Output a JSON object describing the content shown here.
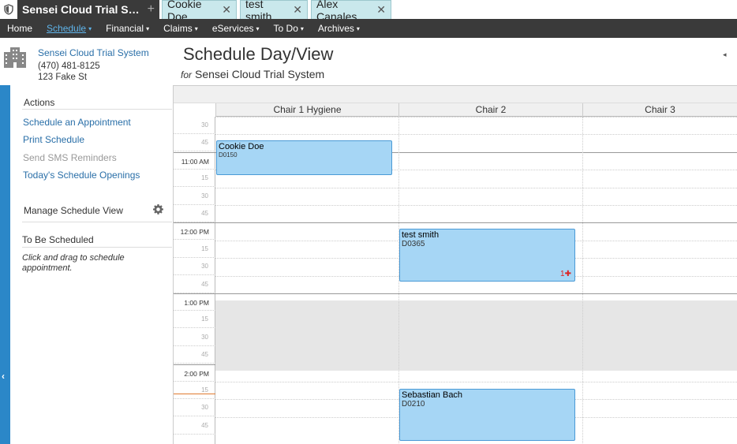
{
  "tabs": {
    "active_label": "Sensei Cloud Trial Syste...",
    "patients": [
      {
        "label": "Cookie Doe"
      },
      {
        "label": "test smith"
      },
      {
        "label": "Alex Canales"
      }
    ],
    "plus": "+",
    "close": "✕"
  },
  "menu": [
    {
      "label": "Home",
      "caret": ""
    },
    {
      "label": "Schedule",
      "caret": "▾"
    },
    {
      "label": "Financial",
      "caret": "▾"
    },
    {
      "label": "Claims",
      "caret": "▾"
    },
    {
      "label": "eServices",
      "caret": "▾"
    },
    {
      "label": "To Do",
      "caret": "▾"
    },
    {
      "label": "Archives",
      "caret": "▾"
    }
  ],
  "practice": {
    "name": "Sensei Cloud Trial System",
    "phone": "(470) 481-8125",
    "address": "123 Fake St"
  },
  "page": {
    "title": "Schedule Day/View",
    "sub_for": "for",
    "sub_name": "Sensei Cloud Trial System",
    "collapse_icon": "◂"
  },
  "sidebar": {
    "actions_heading": "Actions",
    "actions": [
      {
        "label": "Schedule an Appointment",
        "enabled": true
      },
      {
        "label": "Print Schedule",
        "enabled": true
      },
      {
        "label": "Send SMS Reminders",
        "enabled": false
      },
      {
        "label": "Today's Schedule Openings",
        "enabled": true
      }
    ],
    "manage_heading": "Manage Schedule View",
    "to_be_scheduled_heading": "To Be Scheduled",
    "to_be_scheduled_note": "Click and drag to schedule appointment.",
    "collapse_icon": "‹"
  },
  "schedule": {
    "columns": [
      "Chair 1 Hygiene",
      "Chair 2",
      "Chair 3"
    ],
    "time_slots": [
      "30",
      "45",
      "11:00 AM",
      "15",
      "30",
      "45",
      "12:00 PM",
      "15",
      "30",
      "45",
      "1:00 PM",
      "15",
      "30",
      "45",
      "2:00 PM",
      "15",
      "30",
      "45"
    ],
    "appointments": [
      {
        "name": "Cookie Doe",
        "code": "D0150"
      },
      {
        "name": "test smith",
        "code": "D0365",
        "flag_count": "1",
        "flag_icon": "✚"
      },
      {
        "name": "Sebastian Bach",
        "code": "D0210"
      }
    ]
  },
  "colors": {
    "accent_blue": "#2b87c8",
    "menu_bg": "#3a3a3a",
    "appointment_fill": "#a6d6f5",
    "patient_tab": "#c9e8ec"
  }
}
